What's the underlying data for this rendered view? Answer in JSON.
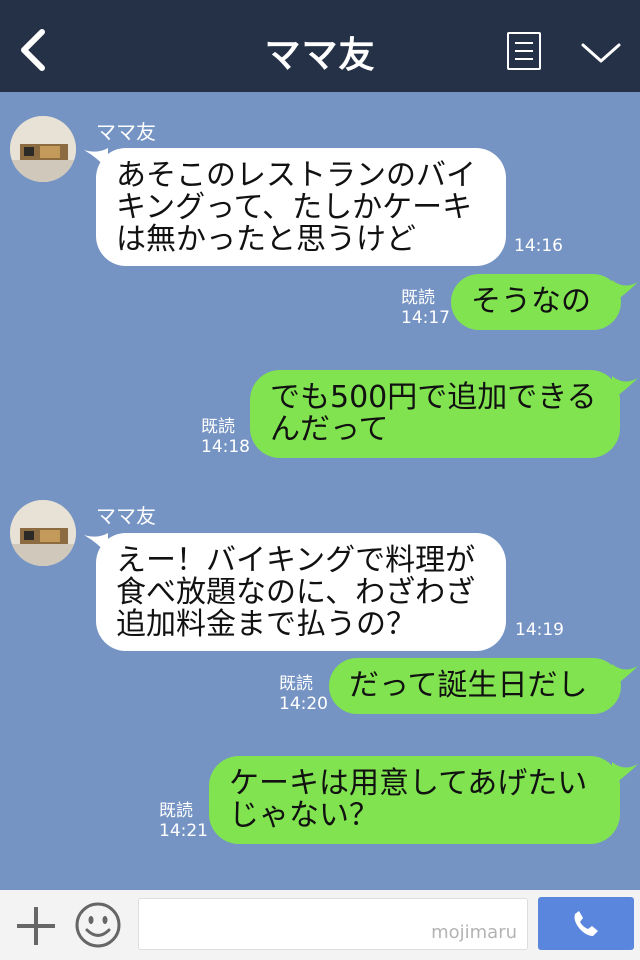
{
  "header": {
    "title": "ママ友",
    "back_icon": "chevron-left-icon",
    "menu_icon": "note-icon",
    "collapse_icon": "chevron-down-icon"
  },
  "messages": [
    {
      "direction": "in",
      "sender": "ママ友",
      "lines": [
        "あそこのレストランのバイ",
        "キングって、たしかケーキ",
        "は無かったと思うけど"
      ],
      "time": "14:16"
    },
    {
      "direction": "out",
      "read": "既読",
      "lines": [
        "そうなの"
      ],
      "time": "14:17"
    },
    {
      "direction": "out",
      "read": "既読",
      "lines": [
        "でも500円で追加できる",
        "んだって"
      ],
      "time": "14:18"
    },
    {
      "direction": "in",
      "sender": "ママ友",
      "lines": [
        "えー！バイキングで料理が",
        "食べ放題なのに、わざわざ",
        "追加料金まで払うの？"
      ],
      "time": "14:19"
    },
    {
      "direction": "out",
      "read": "既読",
      "lines": [
        "だって誕生日だし"
      ],
      "time": "14:20"
    },
    {
      "direction": "out",
      "read": "既読",
      "lines": [
        "ケーキは用意してあげたい",
        "じゃない？"
      ],
      "time": "14:21"
    }
  ],
  "footer": {
    "watermark": "mojimaru",
    "plus_icon": "plus-icon",
    "sticker_icon": "smiley-icon",
    "send_icon": "phone-icon"
  },
  "colors": {
    "background": "#7594c4",
    "header": "#253147",
    "outgoing_bubble": "#80e34f",
    "incoming_bubble": "#ffffff",
    "send_button": "#5a86dd"
  }
}
